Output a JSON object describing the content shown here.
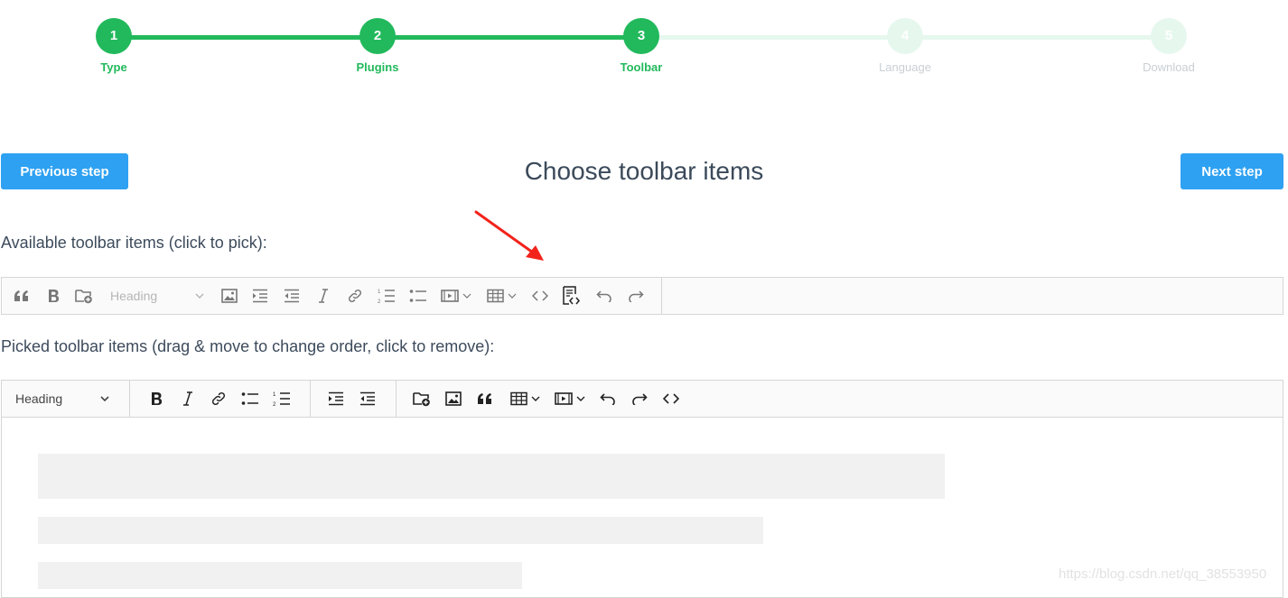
{
  "stepper": {
    "steps": [
      {
        "number": "1",
        "label": "Type",
        "state": "done"
      },
      {
        "number": "2",
        "label": "Plugins",
        "state": "done"
      },
      {
        "number": "3",
        "label": "Toolbar",
        "state": "current"
      },
      {
        "number": "4",
        "label": "Language",
        "state": "todo"
      },
      {
        "number": "5",
        "label": "Download",
        "state": "todo"
      }
    ]
  },
  "header": {
    "prev_label": "Previous step",
    "title": "Choose toolbar items",
    "next_label": "Next step"
  },
  "available": {
    "label": "Available toolbar items (click to pick):",
    "heading_label": "Heading",
    "items": [
      "quote-icon",
      "bold-icon",
      "insert-file-icon",
      "heading-select",
      "image-icon",
      "indent-icon",
      "outdent-icon",
      "italic-icon",
      "link-icon",
      "numbered-list-icon",
      "bulleted-list-icon",
      "media-embed-icon",
      "table-icon",
      "code-icon",
      "source-editing-icon",
      "undo-icon",
      "redo-icon"
    ]
  },
  "picked": {
    "label": "Picked toolbar items (drag & move to change order, click to remove):",
    "heading_label": "Heading",
    "items": [
      "heading-select",
      "bold-icon",
      "italic-icon",
      "link-icon",
      "bulleted-list-icon",
      "numbered-list-icon",
      "indent-icon",
      "outdent-icon",
      "insert-file-icon",
      "image-icon",
      "quote-icon",
      "table-icon",
      "media-embed-icon",
      "undo-icon",
      "redo-icon",
      "code-icon"
    ]
  },
  "colors": {
    "accent_green": "#22b95c",
    "pending_green": "#e6f8ee",
    "button_blue": "#2ea1f2",
    "arrow_red": "#f2231b"
  },
  "watermark": "https://blog.csdn.net/qq_38553950"
}
